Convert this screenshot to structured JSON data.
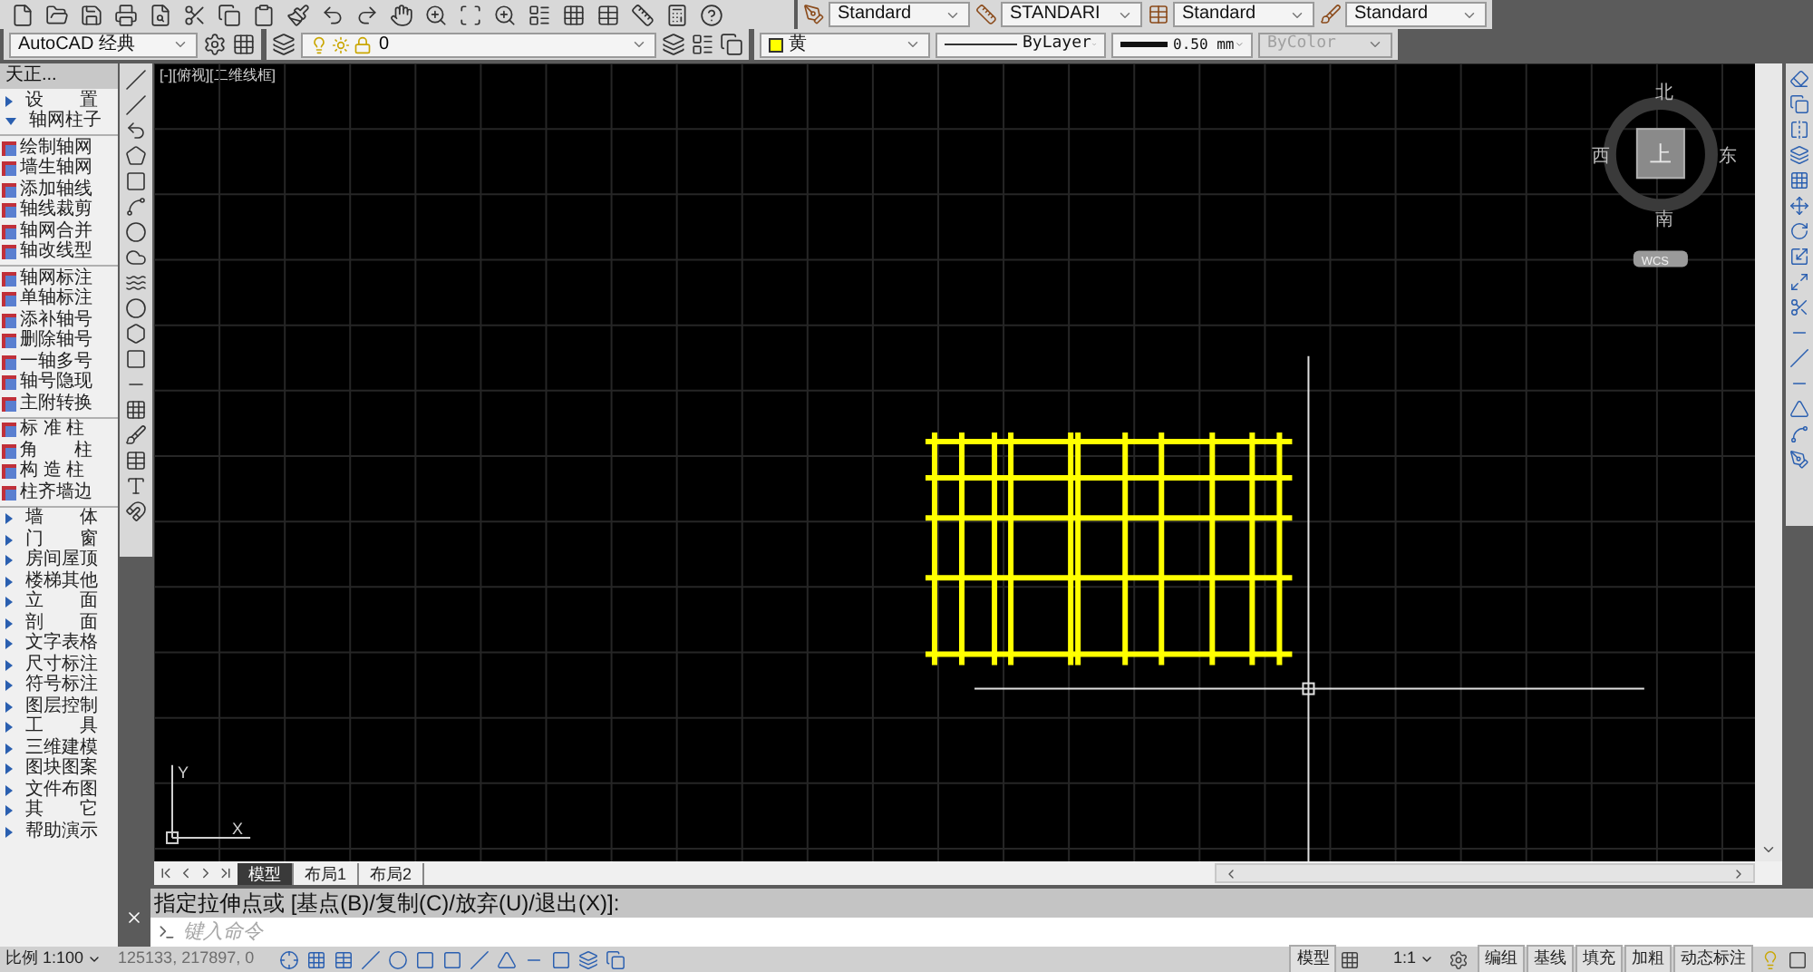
{
  "toolbar": {
    "styles": [
      {
        "kind": "text",
        "value": "Standard"
      },
      {
        "kind": "dim",
        "value": "STANDARI"
      },
      {
        "kind": "table",
        "value": "Standard"
      },
      {
        "kind": "mleader",
        "value": "Standard"
      }
    ],
    "workspace": "AutoCAD 经典",
    "layer": "0",
    "color_label": "黄",
    "linetype": "ByLayer",
    "lineweight": "0.50 mm",
    "plotstyle": {
      "value": "ByColor",
      "disabled": true
    }
  },
  "palette": {
    "title": "天正...",
    "groups": [
      {
        "items": [
          {
            "kind": "section",
            "label": "设　　置",
            "expanded": false
          },
          {
            "kind": "section",
            "label": "轴网柱子",
            "expanded": true
          }
        ]
      },
      {
        "items": [
          {
            "kind": "tool",
            "label": "绘制轴网"
          },
          {
            "kind": "tool",
            "label": "墙生轴网"
          },
          {
            "kind": "tool",
            "label": "添加轴线"
          },
          {
            "kind": "tool",
            "label": "轴线裁剪"
          },
          {
            "kind": "tool",
            "label": "轴网合并"
          },
          {
            "kind": "tool",
            "label": "轴改线型"
          }
        ]
      },
      {
        "items": [
          {
            "kind": "tool",
            "label": "轴网标注"
          },
          {
            "kind": "tool",
            "label": "单轴标注"
          },
          {
            "kind": "tool",
            "label": "添补轴号"
          },
          {
            "kind": "tool",
            "label": "删除轴号"
          },
          {
            "kind": "tool",
            "label": "一轴多号"
          },
          {
            "kind": "tool",
            "label": "轴号隐现"
          },
          {
            "kind": "tool",
            "label": "主附转换"
          }
        ]
      },
      {
        "items": [
          {
            "kind": "tool",
            "label": "标 准 柱"
          },
          {
            "kind": "tool",
            "label": "角　　柱"
          },
          {
            "kind": "tool",
            "label": "构 造 柱"
          },
          {
            "kind": "tool",
            "label": "柱齐墙边"
          }
        ]
      },
      {
        "items": [
          {
            "kind": "section",
            "label": "墙　　体",
            "expanded": false
          },
          {
            "kind": "section",
            "label": "门　　窗",
            "expanded": false
          },
          {
            "kind": "section",
            "label": "房间屋顶",
            "expanded": false
          },
          {
            "kind": "section",
            "label": "楼梯其他",
            "expanded": false
          },
          {
            "kind": "section",
            "label": "立　　面",
            "expanded": false
          },
          {
            "kind": "section",
            "label": "剖　　面",
            "expanded": false
          },
          {
            "kind": "section",
            "label": "文字表格",
            "expanded": false
          },
          {
            "kind": "section",
            "label": "尺寸标注",
            "expanded": false
          },
          {
            "kind": "section",
            "label": "符号标注",
            "expanded": false
          },
          {
            "kind": "section",
            "label": "图层控制",
            "expanded": false
          },
          {
            "kind": "section",
            "label": "工　　具",
            "expanded": false
          },
          {
            "kind": "section",
            "label": "三维建模",
            "expanded": false
          },
          {
            "kind": "section",
            "label": "图块图案",
            "expanded": false
          },
          {
            "kind": "section",
            "label": "文件布图",
            "expanded": false
          },
          {
            "kind": "section",
            "label": "其　　它",
            "expanded": false
          },
          {
            "kind": "section",
            "label": "帮助演示",
            "expanded": false
          }
        ]
      }
    ]
  },
  "viewport": {
    "label": "[-][俯视][二维线框]",
    "viewcube": {
      "north": "北",
      "south": "南",
      "east": "东",
      "west": "西",
      "top": "上",
      "ucs": "WCS"
    },
    "ucs_icon": {
      "x": "X",
      "y": "Y"
    }
  },
  "layout_tabs": [
    {
      "label": "模型",
      "selected": true
    },
    {
      "label": "布局1",
      "selected": false
    },
    {
      "label": "布局2",
      "selected": false
    }
  ],
  "command": {
    "prompt": "指定拉伸点或 [基点(B)/复制(C)/放弃(U)/退出(X)]:",
    "placeholder": "键入命令"
  },
  "status_bar": {
    "scale": "比例 1:100",
    "coordinates": "125133, 217897, 0",
    "model": "模型",
    "annotation_scale": "1:1",
    "toggles": [
      "编组",
      "基线",
      "填充",
      "加粗",
      "动态标注"
    ]
  }
}
